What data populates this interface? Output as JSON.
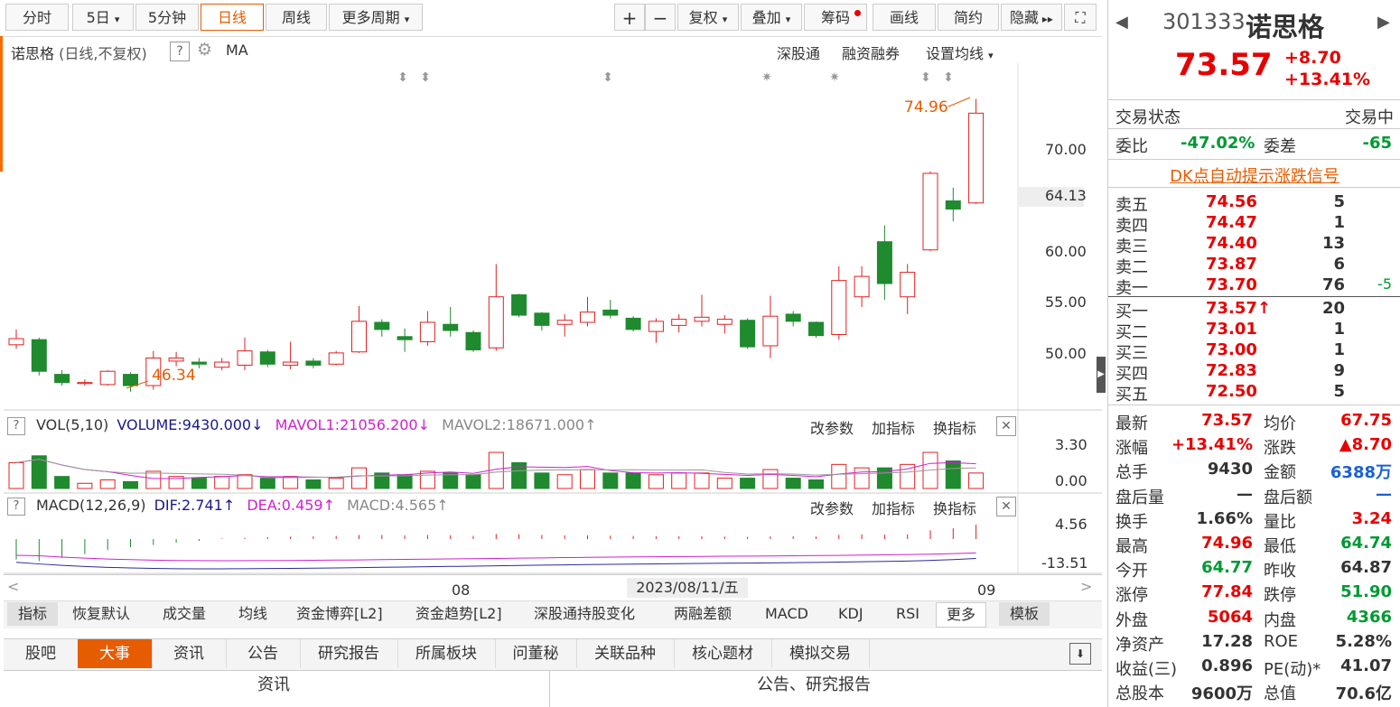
{
  "toolbar": {
    "periods": [
      "分时",
      "5日",
      "5分钟",
      "日线",
      "周线",
      "更多周期"
    ],
    "tools": [
      "+",
      "−",
      "复权",
      "叠加",
      "筹码",
      "画线",
      "简约",
      "隐藏"
    ]
  },
  "chart_header": {
    "title": "诺思格",
    "mode": "(日线,不复权)",
    "help": "?",
    "ma": "MA",
    "links": [
      "深股通",
      "融资融券",
      "设置均线"
    ]
  },
  "price_axis": [
    "70.00",
    "64.13",
    "60.00",
    "55.00",
    "50.00"
  ],
  "high_label": "74.96",
  "low_label": "46.34",
  "vol_header": {
    "name": "VOL(5,10)",
    "volume": "VOLUME:9430.000",
    "mavol1": "MAVOL1:21056.200",
    "mavol2": "MAVOL2:18671.000",
    "actions": [
      "改参数",
      "加指标",
      "换指标"
    ],
    "axis": [
      "3.30",
      "0.00"
    ]
  },
  "macd_header": {
    "name": "MACD(12,26,9)",
    "dif": "DIF:2.741",
    "dea": "DEA:0.459",
    "macd": "MACD:4.565",
    "actions": [
      "改参数",
      "加指标",
      "换指标"
    ],
    "axis": [
      "4.56",
      "-13.51"
    ]
  },
  "date_axis": {
    "left": "08",
    "center": "2023/08/11/五",
    "right": "09"
  },
  "indicator_tabs": [
    "指标",
    "恢复默认",
    "成交量",
    "均线",
    "资金博弈[L2]",
    "资金趋势[L2]",
    "深股通持股变化",
    "两融差额",
    "MACD",
    "KDJ",
    "RSI",
    "更多",
    "模板"
  ],
  "bottom_tabs": [
    "股吧",
    "大事",
    "资讯",
    "公告",
    "研究报告",
    "所属板块",
    "问董秘",
    "关联品种",
    "核心题材",
    "模拟交易"
  ],
  "bottom_sections": [
    "资讯",
    "公告、研究报告"
  ],
  "quote": {
    "code": "301333",
    "name": "诺思格",
    "price": "73.57",
    "change": "+8.70",
    "change_pct": "+13.41%",
    "status_label": "交易状态",
    "status": "交易中",
    "weibi_label": "委比",
    "weibi": "-47.02%",
    "weicha_label": "委差",
    "weicha": "-65",
    "dk_link": "DK点自动提示涨跌信号"
  },
  "order_book": {
    "asks": [
      {
        "label": "卖五",
        "price": "74.56",
        "vol": "5",
        "extra": ""
      },
      {
        "label": "卖四",
        "price": "74.47",
        "vol": "1",
        "extra": ""
      },
      {
        "label": "卖三",
        "price": "74.40",
        "vol": "13",
        "extra": ""
      },
      {
        "label": "卖二",
        "price": "73.87",
        "vol": "6",
        "extra": ""
      },
      {
        "label": "卖一",
        "price": "73.70",
        "vol": "76",
        "extra": "-5"
      }
    ],
    "bids": [
      {
        "label": "买一",
        "price": "73.57",
        "vol": "20",
        "extra": ""
      },
      {
        "label": "买二",
        "price": "73.01",
        "vol": "1",
        "extra": ""
      },
      {
        "label": "买三",
        "price": "73.00",
        "vol": "1",
        "extra": ""
      },
      {
        "label": "买四",
        "price": "72.83",
        "vol": "9",
        "extra": ""
      },
      {
        "label": "买五",
        "price": "72.50",
        "vol": "5",
        "extra": ""
      }
    ]
  },
  "stats": [
    {
      "l1": "最新",
      "v1": "73.57",
      "c1": "up",
      "l2": "均价",
      "v2": "67.75",
      "c2": "up"
    },
    {
      "l1": "涨幅",
      "v1": "+13.41%",
      "c1": "up",
      "l2": "涨跌",
      "v2": "▲8.70",
      "c2": "up"
    },
    {
      "l1": "总手",
      "v1": "9430",
      "c1": "",
      "l2": "金额",
      "v2": "6388万",
      "c2": "blue"
    },
    {
      "l1": "盘后量",
      "v1": "—",
      "c1": "",
      "l2": "盘后额",
      "v2": "—",
      "c2": "blue"
    },
    {
      "l1": "换手",
      "v1": "1.66%",
      "c1": "",
      "l2": "量比",
      "v2": "3.24",
      "c2": "up"
    },
    {
      "l1": "最高",
      "v1": "74.96",
      "c1": "up",
      "l2": "最低",
      "v2": "64.74",
      "c2": "down"
    },
    {
      "l1": "今开",
      "v1": "64.77",
      "c1": "down",
      "l2": "昨收",
      "v2": "64.87",
      "c2": ""
    },
    {
      "l1": "涨停",
      "v1": "77.84",
      "c1": "up",
      "l2": "跌停",
      "v2": "51.90",
      "c2": "down"
    },
    {
      "l1": "外盘",
      "v1": "5064",
      "c1": "up",
      "l2": "内盘",
      "v2": "4366",
      "c2": "down"
    },
    {
      "l1": "净资产",
      "v1": "17.28",
      "c1": "",
      "l2": "ROE",
      "v2": "5.28%",
      "c2": ""
    },
    {
      "l1": "收益(三)",
      "v1": "0.896",
      "c1": "",
      "l2": "PE(动)*",
      "v2": "41.07",
      "c2": ""
    },
    {
      "l1": "总股本",
      "v1": "9600万",
      "c1": "",
      "l2": "总值",
      "v2": "70.6亿",
      "c2": ""
    }
  ],
  "chart_data": {
    "type": "candlestick",
    "ylim": [
      44,
      77
    ],
    "candles": [
      {
        "o": 50.9,
        "c": 51.5,
        "h": 52.4,
        "l": 50.5
      },
      {
        "o": 51.4,
        "c": 48.3,
        "h": 51.6,
        "l": 47.9
      },
      {
        "o": 48.0,
        "c": 47.2,
        "h": 48.4,
        "l": 46.9
      },
      {
        "o": 47.1,
        "c": 47.2,
        "h": 47.5,
        "l": 46.9
      },
      {
        "o": 47.0,
        "c": 48.3,
        "h": 48.4,
        "l": 46.9
      },
      {
        "o": 48.0,
        "c": 46.9,
        "h": 48.2,
        "l": 46.3
      },
      {
        "o": 46.9,
        "c": 49.6,
        "h": 50.3,
        "l": 46.5
      },
      {
        "o": 49.3,
        "c": 49.6,
        "h": 50.2,
        "l": 48.8
      },
      {
        "o": 49.2,
        "c": 49.0,
        "h": 49.6,
        "l": 48.6
      },
      {
        "o": 48.7,
        "c": 49.2,
        "h": 49.6,
        "l": 48.4
      },
      {
        "o": 48.9,
        "c": 50.3,
        "h": 51.6,
        "l": 48.4
      },
      {
        "o": 50.2,
        "c": 49.0,
        "h": 50.4,
        "l": 48.7
      },
      {
        "o": 48.9,
        "c": 49.2,
        "h": 51.2,
        "l": 48.5
      },
      {
        "o": 49.3,
        "c": 48.9,
        "h": 49.6,
        "l": 48.6
      },
      {
        "o": 49.0,
        "c": 50.1,
        "h": 50.3,
        "l": 48.9
      },
      {
        "o": 50.2,
        "c": 53.2,
        "h": 54.7,
        "l": 50.1
      },
      {
        "o": 53.1,
        "c": 52.4,
        "h": 53.4,
        "l": 51.7
      },
      {
        "o": 51.7,
        "c": 51.4,
        "h": 52.5,
        "l": 50.2
      },
      {
        "o": 51.2,
        "c": 53.1,
        "h": 54.2,
        "l": 50.8
      },
      {
        "o": 52.9,
        "c": 52.3,
        "h": 54.6,
        "l": 51.7
      },
      {
        "o": 52.1,
        "c": 50.4,
        "h": 52.3,
        "l": 50.2
      },
      {
        "o": 50.6,
        "c": 55.6,
        "h": 58.8,
        "l": 50.3
      },
      {
        "o": 55.8,
        "c": 53.8,
        "h": 55.9,
        "l": 53.6
      },
      {
        "o": 54.0,
        "c": 52.8,
        "h": 54.1,
        "l": 52.3
      },
      {
        "o": 52.9,
        "c": 53.3,
        "h": 53.9,
        "l": 51.7
      },
      {
        "o": 53.1,
        "c": 54.1,
        "h": 55.6,
        "l": 52.7
      },
      {
        "o": 54.3,
        "c": 53.8,
        "h": 55.3,
        "l": 53.5
      },
      {
        "o": 53.5,
        "c": 52.4,
        "h": 53.7,
        "l": 52.2
      },
      {
        "o": 52.2,
        "c": 53.2,
        "h": 53.5,
        "l": 51.1
      },
      {
        "o": 52.8,
        "c": 53.4,
        "h": 53.9,
        "l": 52.1
      },
      {
        "o": 53.2,
        "c": 53.6,
        "h": 55.8,
        "l": 52.7
      },
      {
        "o": 52.9,
        "c": 53.4,
        "h": 53.8,
        "l": 52.0
      },
      {
        "o": 53.3,
        "c": 50.7,
        "h": 53.5,
        "l": 50.5
      },
      {
        "o": 50.8,
        "c": 53.7,
        "h": 55.7,
        "l": 49.6
      },
      {
        "o": 53.9,
        "c": 53.2,
        "h": 54.2,
        "l": 52.7
      },
      {
        "o": 53.1,
        "c": 51.8,
        "h": 53.2,
        "l": 51.6
      },
      {
        "o": 51.9,
        "c": 57.2,
        "h": 58.6,
        "l": 51.4
      },
      {
        "o": 55.6,
        "c": 57.6,
        "h": 58.6,
        "l": 54.6
      },
      {
        "o": 61.0,
        "c": 56.9,
        "h": 62.6,
        "l": 55.3
      },
      {
        "o": 55.6,
        "c": 58.0,
        "h": 58.8,
        "l": 53.9
      },
      {
        "o": 60.2,
        "c": 67.7,
        "h": 67.9,
        "l": 60.1
      },
      {
        "o": 65.0,
        "c": 64.2,
        "h": 66.3,
        "l": 63.0
      },
      {
        "o": 64.8,
        "c": 73.6,
        "h": 75.0,
        "l": 64.7
      }
    ],
    "volume": [
      1.5,
      1.9,
      0.7,
      0.3,
      0.5,
      0.4,
      1.0,
      0.7,
      0.6,
      0.7,
      0.8,
      0.6,
      0.7,
      0.5,
      0.6,
      1.2,
      0.9,
      0.8,
      1.0,
      0.9,
      0.8,
      2.1,
      1.5,
      0.9,
      0.8,
      1.1,
      0.9,
      0.9,
      0.8,
      0.9,
      0.9,
      0.6,
      0.6,
      1.1,
      0.6,
      0.5,
      1.4,
      1.2,
      1.2,
      1.4,
      2.1,
      1.6,
      0.9
    ],
    "macd_hist": [
      -6.5,
      -7.0,
      -6.0,
      -4.8,
      -3.5,
      -2.6,
      -1.9,
      -1.2,
      -0.6,
      0.2,
      0.4,
      0.6,
      0.8,
      0.9,
      1.0,
      1.3,
      1.3,
      1.2,
      1.3,
      1.2,
      1.0,
      1.6,
      1.5,
      1.3,
      1.2,
      1.2,
      1.1,
      1.0,
      0.9,
      0.9,
      0.9,
      0.8,
      0.7,
      0.9,
      0.9,
      0.8,
      1.3,
      1.5,
      1.4,
      1.5,
      2.8,
      3.4,
      4.6
    ]
  }
}
